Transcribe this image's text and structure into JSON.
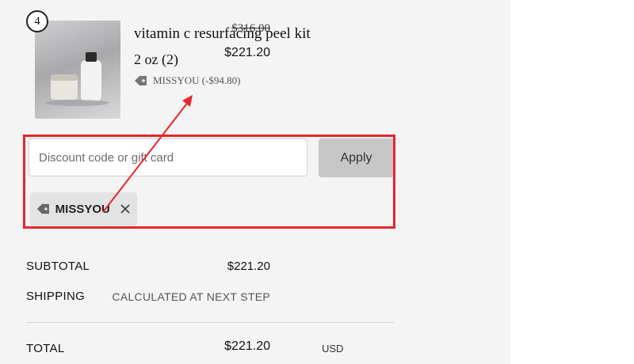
{
  "line_item": {
    "quantity": "4",
    "title": "vitamin c resurfacing peel kit",
    "variant": "2 oz (2)",
    "discount_note": "MISSYOU (-$94.80)",
    "original_price": "$316.00",
    "sale_price": "$221.20"
  },
  "discount": {
    "placeholder": "Discount code or gift card",
    "value": "",
    "apply_label": "Apply",
    "applied_code": "MISSYOU"
  },
  "summary": {
    "subtotal_label": "SUBTOTAL",
    "subtotal_value": "$221.20",
    "shipping_label": "SHIPPING",
    "shipping_value": "CALCULATED AT NEXT STEP",
    "total_label": "TOTAL",
    "total_currency": "USD",
    "total_value": "$221.20"
  },
  "colors": {
    "annotation": "#e8262a",
    "panel_bg": "#f5f4f4",
    "button_bg": "#c7c7c7"
  },
  "icons": [
    "tag-icon",
    "close-icon"
  ]
}
